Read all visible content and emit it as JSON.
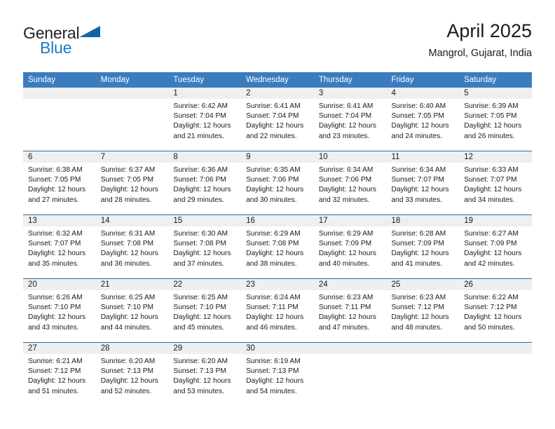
{
  "logo": {
    "word_top": "General",
    "word_bottom": "Blue",
    "triangle_icon": "triangle-icon"
  },
  "header": {
    "month_title": "April 2025",
    "location": "Mangrol, Gujarat, India"
  },
  "calendar": {
    "weekday_headers": [
      "Sunday",
      "Monday",
      "Tuesday",
      "Wednesday",
      "Thursday",
      "Friday",
      "Saturday"
    ],
    "colors": {
      "header_blue": "#3b7cbf",
      "row_separator_blue": "#2d6ba8",
      "daynum_band_gray": "#efefef",
      "logo_blue": "#1b7cc4"
    },
    "weeks": [
      [
        {
          "day": "",
          "empty": true,
          "sunrise": "",
          "sunset": "",
          "daylight_line1": "",
          "daylight_line2": ""
        },
        {
          "day": "",
          "empty": true,
          "sunrise": "",
          "sunset": "",
          "daylight_line1": "",
          "daylight_line2": ""
        },
        {
          "day": "1",
          "sunrise": "Sunrise: 6:42 AM",
          "sunset": "Sunset: 7:04 PM",
          "daylight_line1": "Daylight: 12 hours",
          "daylight_line2": "and 21 minutes."
        },
        {
          "day": "2",
          "sunrise": "Sunrise: 6:41 AM",
          "sunset": "Sunset: 7:04 PM",
          "daylight_line1": "Daylight: 12 hours",
          "daylight_line2": "and 22 minutes."
        },
        {
          "day": "3",
          "sunrise": "Sunrise: 6:41 AM",
          "sunset": "Sunset: 7:04 PM",
          "daylight_line1": "Daylight: 12 hours",
          "daylight_line2": "and 23 minutes."
        },
        {
          "day": "4",
          "sunrise": "Sunrise: 6:40 AM",
          "sunset": "Sunset: 7:05 PM",
          "daylight_line1": "Daylight: 12 hours",
          "daylight_line2": "and 24 minutes."
        },
        {
          "day": "5",
          "sunrise": "Sunrise: 6:39 AM",
          "sunset": "Sunset: 7:05 PM",
          "daylight_line1": "Daylight: 12 hours",
          "daylight_line2": "and 26 minutes."
        }
      ],
      [
        {
          "day": "6",
          "sunrise": "Sunrise: 6:38 AM",
          "sunset": "Sunset: 7:05 PM",
          "daylight_line1": "Daylight: 12 hours",
          "daylight_line2": "and 27 minutes."
        },
        {
          "day": "7",
          "sunrise": "Sunrise: 6:37 AM",
          "sunset": "Sunset: 7:05 PM",
          "daylight_line1": "Daylight: 12 hours",
          "daylight_line2": "and 28 minutes."
        },
        {
          "day": "8",
          "sunrise": "Sunrise: 6:36 AM",
          "sunset": "Sunset: 7:06 PM",
          "daylight_line1": "Daylight: 12 hours",
          "daylight_line2": "and 29 minutes."
        },
        {
          "day": "9",
          "sunrise": "Sunrise: 6:35 AM",
          "sunset": "Sunset: 7:06 PM",
          "daylight_line1": "Daylight: 12 hours",
          "daylight_line2": "and 30 minutes."
        },
        {
          "day": "10",
          "sunrise": "Sunrise: 6:34 AM",
          "sunset": "Sunset: 7:06 PM",
          "daylight_line1": "Daylight: 12 hours",
          "daylight_line2": "and 32 minutes."
        },
        {
          "day": "11",
          "sunrise": "Sunrise: 6:34 AM",
          "sunset": "Sunset: 7:07 PM",
          "daylight_line1": "Daylight: 12 hours",
          "daylight_line2": "and 33 minutes."
        },
        {
          "day": "12",
          "sunrise": "Sunrise: 6:33 AM",
          "sunset": "Sunset: 7:07 PM",
          "daylight_line1": "Daylight: 12 hours",
          "daylight_line2": "and 34 minutes."
        }
      ],
      [
        {
          "day": "13",
          "sunrise": "Sunrise: 6:32 AM",
          "sunset": "Sunset: 7:07 PM",
          "daylight_line1": "Daylight: 12 hours",
          "daylight_line2": "and 35 minutes."
        },
        {
          "day": "14",
          "sunrise": "Sunrise: 6:31 AM",
          "sunset": "Sunset: 7:08 PM",
          "daylight_line1": "Daylight: 12 hours",
          "daylight_line2": "and 36 minutes."
        },
        {
          "day": "15",
          "sunrise": "Sunrise: 6:30 AM",
          "sunset": "Sunset: 7:08 PM",
          "daylight_line1": "Daylight: 12 hours",
          "daylight_line2": "and 37 minutes."
        },
        {
          "day": "16",
          "sunrise": "Sunrise: 6:29 AM",
          "sunset": "Sunset: 7:08 PM",
          "daylight_line1": "Daylight: 12 hours",
          "daylight_line2": "and 38 minutes."
        },
        {
          "day": "17",
          "sunrise": "Sunrise: 6:29 AM",
          "sunset": "Sunset: 7:09 PM",
          "daylight_line1": "Daylight: 12 hours",
          "daylight_line2": "and 40 minutes."
        },
        {
          "day": "18",
          "sunrise": "Sunrise: 6:28 AM",
          "sunset": "Sunset: 7:09 PM",
          "daylight_line1": "Daylight: 12 hours",
          "daylight_line2": "and 41 minutes."
        },
        {
          "day": "19",
          "sunrise": "Sunrise: 6:27 AM",
          "sunset": "Sunset: 7:09 PM",
          "daylight_line1": "Daylight: 12 hours",
          "daylight_line2": "and 42 minutes."
        }
      ],
      [
        {
          "day": "20",
          "sunrise": "Sunrise: 6:26 AM",
          "sunset": "Sunset: 7:10 PM",
          "daylight_line1": "Daylight: 12 hours",
          "daylight_line2": "and 43 minutes."
        },
        {
          "day": "21",
          "sunrise": "Sunrise: 6:25 AM",
          "sunset": "Sunset: 7:10 PM",
          "daylight_line1": "Daylight: 12 hours",
          "daylight_line2": "and 44 minutes."
        },
        {
          "day": "22",
          "sunrise": "Sunrise: 6:25 AM",
          "sunset": "Sunset: 7:10 PM",
          "daylight_line1": "Daylight: 12 hours",
          "daylight_line2": "and 45 minutes."
        },
        {
          "day": "23",
          "sunrise": "Sunrise: 6:24 AM",
          "sunset": "Sunset: 7:11 PM",
          "daylight_line1": "Daylight: 12 hours",
          "daylight_line2": "and 46 minutes."
        },
        {
          "day": "24",
          "sunrise": "Sunrise: 6:23 AM",
          "sunset": "Sunset: 7:11 PM",
          "daylight_line1": "Daylight: 12 hours",
          "daylight_line2": "and 47 minutes."
        },
        {
          "day": "25",
          "sunrise": "Sunrise: 6:23 AM",
          "sunset": "Sunset: 7:12 PM",
          "daylight_line1": "Daylight: 12 hours",
          "daylight_line2": "and 48 minutes."
        },
        {
          "day": "26",
          "sunrise": "Sunrise: 6:22 AM",
          "sunset": "Sunset: 7:12 PM",
          "daylight_line1": "Daylight: 12 hours",
          "daylight_line2": "and 50 minutes."
        }
      ],
      [
        {
          "day": "27",
          "sunrise": "Sunrise: 6:21 AM",
          "sunset": "Sunset: 7:12 PM",
          "daylight_line1": "Daylight: 12 hours",
          "daylight_line2": "and 51 minutes."
        },
        {
          "day": "28",
          "sunrise": "Sunrise: 6:20 AM",
          "sunset": "Sunset: 7:13 PM",
          "daylight_line1": "Daylight: 12 hours",
          "daylight_line2": "and 52 minutes."
        },
        {
          "day": "29",
          "sunrise": "Sunrise: 6:20 AM",
          "sunset": "Sunset: 7:13 PM",
          "daylight_line1": "Daylight: 12 hours",
          "daylight_line2": "and 53 minutes."
        },
        {
          "day": "30",
          "sunrise": "Sunrise: 6:19 AM",
          "sunset": "Sunset: 7:13 PM",
          "daylight_line1": "Daylight: 12 hours",
          "daylight_line2": "and 54 minutes."
        },
        {
          "day": "",
          "empty": true,
          "sunrise": "",
          "sunset": "",
          "daylight_line1": "",
          "daylight_line2": ""
        },
        {
          "day": "",
          "empty": true,
          "sunrise": "",
          "sunset": "",
          "daylight_line1": "",
          "daylight_line2": ""
        },
        {
          "day": "",
          "empty": true,
          "sunrise": "",
          "sunset": "",
          "daylight_line1": "",
          "daylight_line2": ""
        }
      ]
    ]
  }
}
